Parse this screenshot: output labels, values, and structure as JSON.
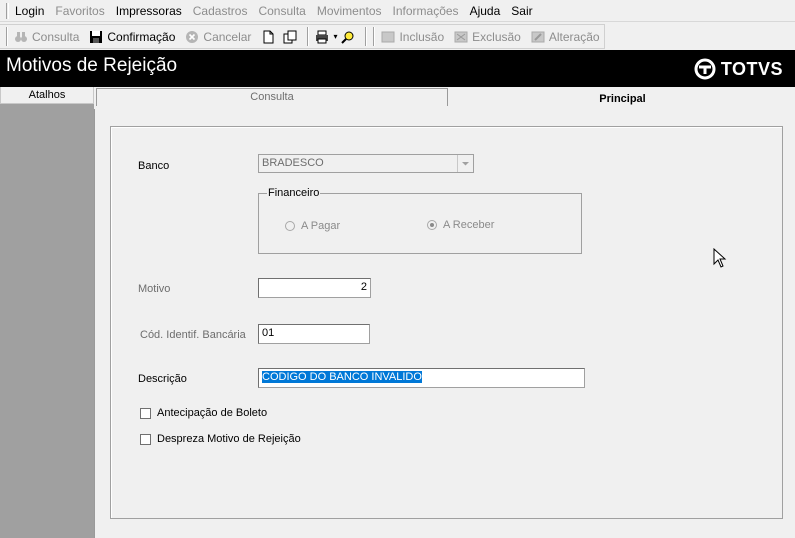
{
  "menu": {
    "items": [
      {
        "label": "Login",
        "enabled": true
      },
      {
        "label": "Favoritos",
        "enabled": false
      },
      {
        "label": "Impressoras",
        "enabled": true
      },
      {
        "label": "Cadastros",
        "enabled": false
      },
      {
        "label": "Consulta",
        "enabled": false
      },
      {
        "label": "Movimentos",
        "enabled": false
      },
      {
        "label": "Informações",
        "enabled": false
      },
      {
        "label": "Ajuda",
        "enabled": true
      },
      {
        "label": "Sair",
        "enabled": true
      }
    ]
  },
  "toolbar": {
    "consulta": "Consulta",
    "confirmacao": "Confirmação",
    "cancelar": "Cancelar",
    "inclusao": "Inclusão",
    "exclusao": "Exclusão",
    "alteracao": "Alteração"
  },
  "window": {
    "title": "Motivos de Rejeição",
    "brand": "TOTVS"
  },
  "sidebar": {
    "header": "Atalhos"
  },
  "tabs": {
    "consulta": "Consulta",
    "principal": "Principal"
  },
  "form": {
    "banco_label": "Banco",
    "banco_value": "BRADESCO",
    "financeiro_label": "Financeiro",
    "a_pagar": "A Pagar",
    "a_receber": "A Receber",
    "financeiro_selected": "A Receber",
    "motivo_label": "Motivo",
    "motivo_value": "2",
    "cod_label": "Cód. Identif. Bancária",
    "cod_value": "01",
    "descricao_label": "Descrição",
    "descricao_value": "CODIGO DO BANCO INVALIDO",
    "antecipacao_label": "Antecipação de Boleto",
    "despreza_label": "Despreza Motivo de Rejeição"
  },
  "colors": {
    "titlebar": "#000000",
    "selection": "#0078d7",
    "sidebar": "#a0a0a0"
  }
}
